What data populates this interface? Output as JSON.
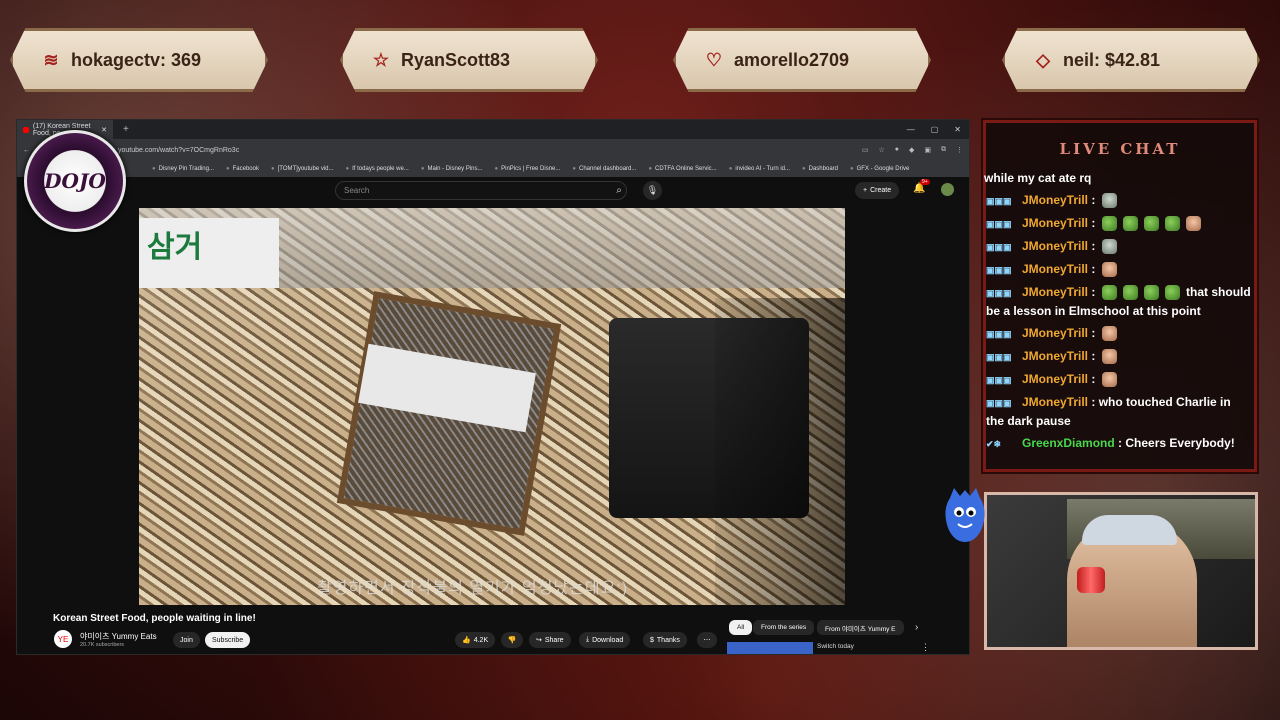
{
  "plaques": [
    {
      "icon": "coin-stack-icon",
      "text": "hokagectv: 369"
    },
    {
      "icon": "star-icon",
      "text": "RyanScott83"
    },
    {
      "icon": "heart-icon",
      "text": "amorello2709"
    },
    {
      "icon": "gem-icon",
      "text": "neil: $42.81"
    }
  ],
  "browser": {
    "tab_title": "(17) Korean Street Food, pe",
    "url": "youtube.com/watch?v=7OCmgRnRo3c",
    "bookmarks": [
      "Disney Pin Trading...",
      "Facebook",
      "[TOMT]youtube vid...",
      "If todays people we...",
      "Main - Disney Pins...",
      "PinPics | Free Disne...",
      "Channel dashboard...",
      "CDTFA Online Servic...",
      "invideo AI - Turn id...",
      "Dashboard",
      "GFX - Google Drive"
    ]
  },
  "youtube": {
    "search_placeholder": "Search",
    "create_label": "Create",
    "notifications_badge": "9+",
    "video_subtitle": "촬영하면서 장작불의 열기가 엄청났는데요:)",
    "video_title": "Korean Street Food, people waiting in line!",
    "channel_avatar_text": "YE",
    "channel_name": "야미이츠 Yummy Eats",
    "subscribers": "20.7K subscribers",
    "join_label": "Join",
    "subscribe_label": "Subscribe",
    "like_count": "4.2K",
    "share_label": "Share",
    "download_label": "Download",
    "thanks_label": "Thanks",
    "chips": [
      "All",
      "From the series",
      "From 야미이츠 Yummy E"
    ],
    "switch_label": "Switch today"
  },
  "logo": {
    "text": "DOJO"
  },
  "chat": {
    "title": "LIVE CHAT",
    "messages": [
      {
        "user": "",
        "text": "while my cat ate rq",
        "emotes": []
      },
      {
        "user": "JMoneyTrill",
        "text": "",
        "emotes": [
          "gray"
        ]
      },
      {
        "user": "JMoneyTrill",
        "text": "",
        "emotes": [
          "pepe",
          "pepe",
          "pepe",
          "pepe",
          "face"
        ]
      },
      {
        "user": "JMoneyTrill",
        "text": "",
        "emotes": [
          "gray"
        ]
      },
      {
        "user": "JMoneyTrill",
        "text": "",
        "emotes": [
          "face"
        ]
      },
      {
        "user": "JMoneyTrill",
        "text": "that should be a lesson in Elmschool at this point",
        "emotes": [
          "pepe",
          "pepe",
          "pepe",
          "pepe"
        ]
      },
      {
        "user": "JMoneyTrill",
        "text": "",
        "emotes": [
          "face"
        ]
      },
      {
        "user": "JMoneyTrill",
        "text": "",
        "emotes": [
          "face"
        ]
      },
      {
        "user": "JMoneyTrill",
        "text": "",
        "emotes": [
          "face"
        ]
      },
      {
        "user": "JMoneyTrill",
        "text": "who touched Charlie in the dark pause",
        "emotes": []
      },
      {
        "user": "GreenxDiamond",
        "text": "Cheers Everybody!",
        "emotes": [],
        "green": true
      }
    ]
  }
}
